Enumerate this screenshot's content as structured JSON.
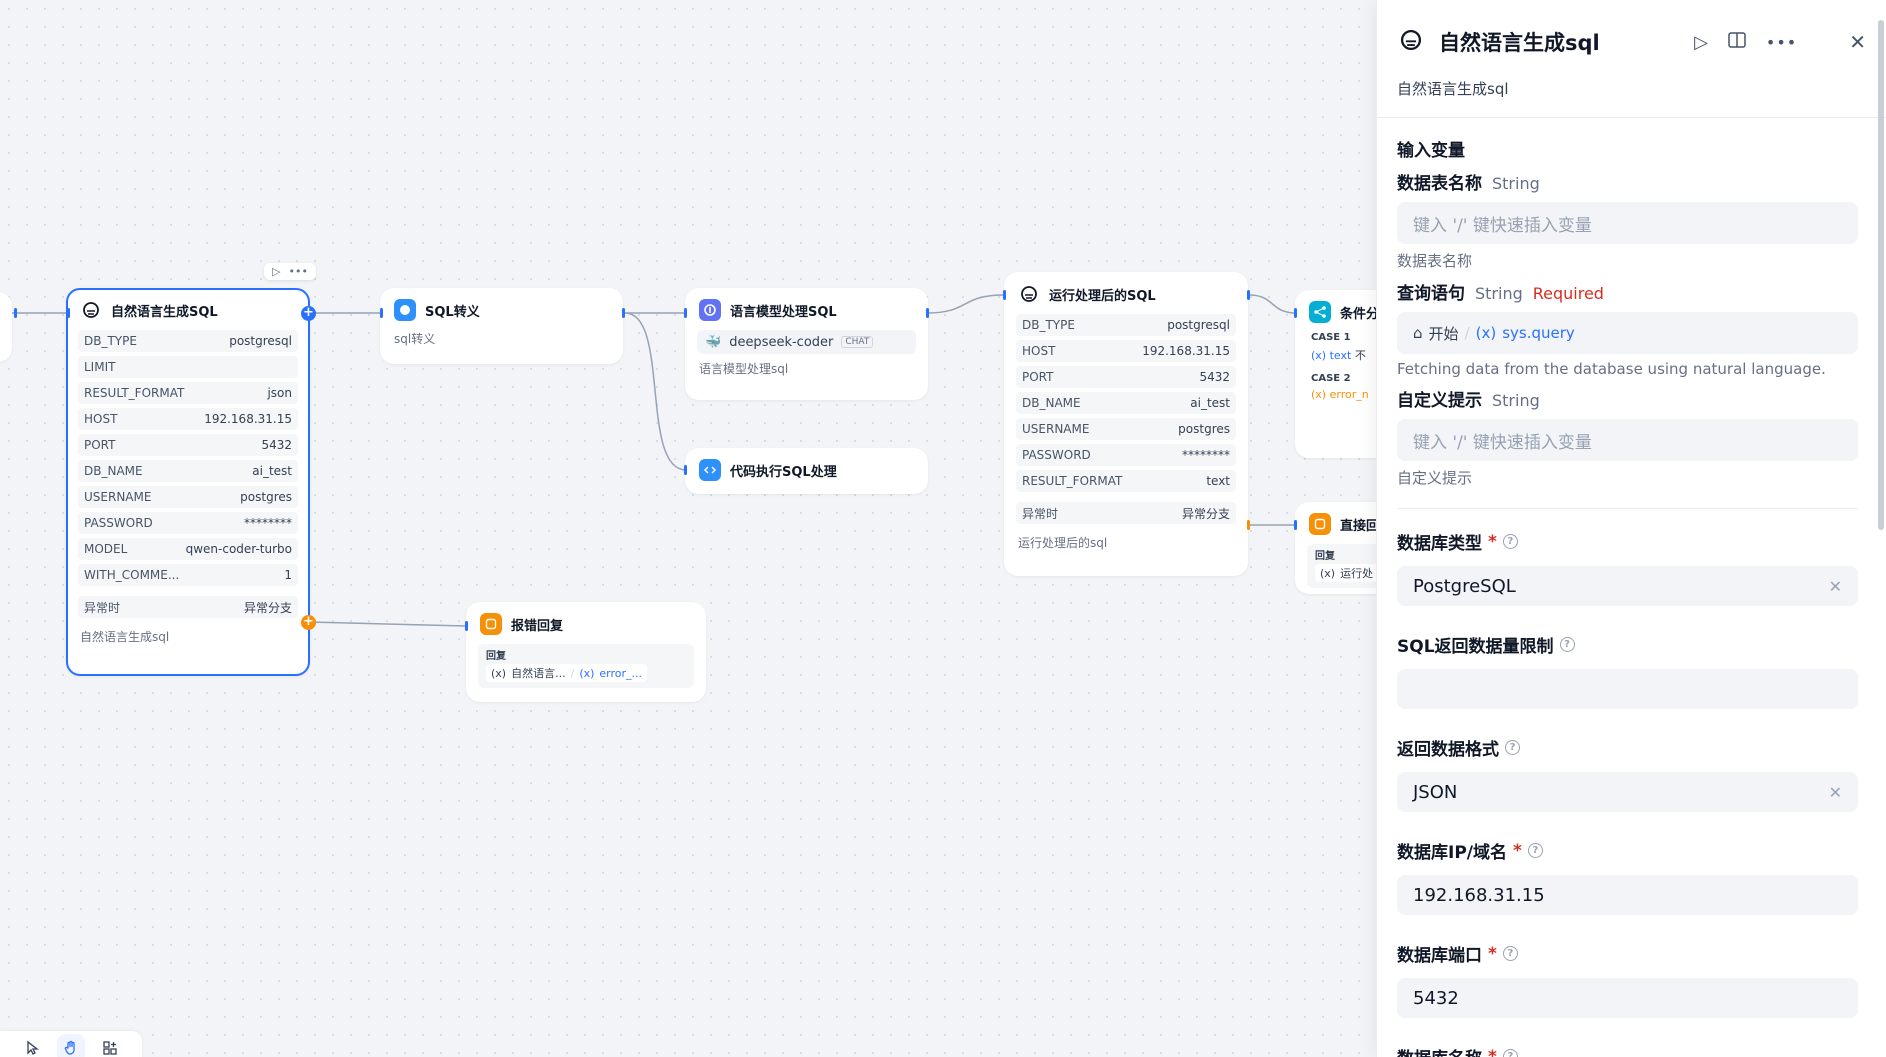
{
  "canvas": {
    "node_main": {
      "title": "自然语言生成SQL",
      "rows": [
        {
          "k": "DB_TYPE",
          "v": "postgresql"
        },
        {
          "k": "LIMIT",
          "v": ""
        },
        {
          "k": "RESULT_FORMAT",
          "v": "json"
        },
        {
          "k": "HOST",
          "v": "192.168.31.15"
        },
        {
          "k": "PORT",
          "v": "5432"
        },
        {
          "k": "DB_NAME",
          "v": "ai_test"
        },
        {
          "k": "USERNAME",
          "v": "postgres"
        },
        {
          "k": "PASSWORD",
          "v": "********"
        },
        {
          "k": "MODEL",
          "v": "qwen-coder-turbo"
        },
        {
          "k": "WITH_COMME...",
          "v": "1"
        }
      ],
      "exception_label": "异常时",
      "exception_value": "异常分支",
      "desc": "自然语言生成sql"
    },
    "node_sql_escape": {
      "title": "SQL转义",
      "desc": "sql转义"
    },
    "node_llm": {
      "title": "语言模型处理SQL",
      "model": "deepseek-coder",
      "model_tag": "CHAT",
      "desc": "语言模型处理sql"
    },
    "node_code": {
      "title": "代码执行SQL处理"
    },
    "node_run": {
      "title": "运行处理后的SQL",
      "rows": [
        {
          "k": "DB_TYPE",
          "v": "postgresql"
        },
        {
          "k": "HOST",
          "v": "192.168.31.15"
        },
        {
          "k": "PORT",
          "v": "5432"
        },
        {
          "k": "DB_NAME",
          "v": "ai_test"
        },
        {
          "k": "USERNAME",
          "v": "postgres"
        },
        {
          "k": "PASSWORD",
          "v": "********"
        },
        {
          "k": "RESULT_FORMAT",
          "v": "text"
        }
      ],
      "exception_label": "异常时",
      "exception_value": "异常分支",
      "desc": "运行处理后的sql"
    },
    "node_condition": {
      "title": "条件分",
      "case1": "CASE 1",
      "case1_var": "text",
      "case1_op": "不",
      "case2": "CASE 2",
      "case2_var": "error_n"
    },
    "node_direct": {
      "title": "直接回",
      "reply_label": "回复",
      "reply_var": "运行处"
    },
    "node_error": {
      "title": "报错回复",
      "reply_label": "回复",
      "var1": "自然语言...",
      "var2": "error_..."
    }
  },
  "panel": {
    "title": "自然语言生成sql",
    "desc": "自然语言生成sql",
    "input_section": "输入变量",
    "var1": {
      "label": "数据表名称",
      "type": "String",
      "placeholder": "键入 '/' 键快速插入变量",
      "hint": "数据表名称"
    },
    "var2": {
      "label": "查询语句",
      "type": "String",
      "required": "Required",
      "source": "开始",
      "var": "sys.query",
      "hint": "Fetching data from the database using natural language."
    },
    "var3": {
      "label": "自定义提示",
      "type": "String",
      "placeholder": "键入 '/' 键快速插入变量",
      "hint": "自定义提示"
    },
    "db_type": {
      "label": "数据库类型",
      "value": "PostgreSQL"
    },
    "limit": {
      "label": "SQL返回数据量限制",
      "value": ""
    },
    "format": {
      "label": "返回数据格式",
      "value": "JSON"
    },
    "host": {
      "label": "数据库IP/域名",
      "value": "192.168.31.15"
    },
    "port": {
      "label": "数据库端口",
      "value": "5432"
    },
    "dbname": {
      "label": "数据库名称"
    }
  },
  "colors": {
    "accent": "#2970ff",
    "orange": "#f79009",
    "teal": "#06aed4",
    "indigo": "#6172f3"
  }
}
